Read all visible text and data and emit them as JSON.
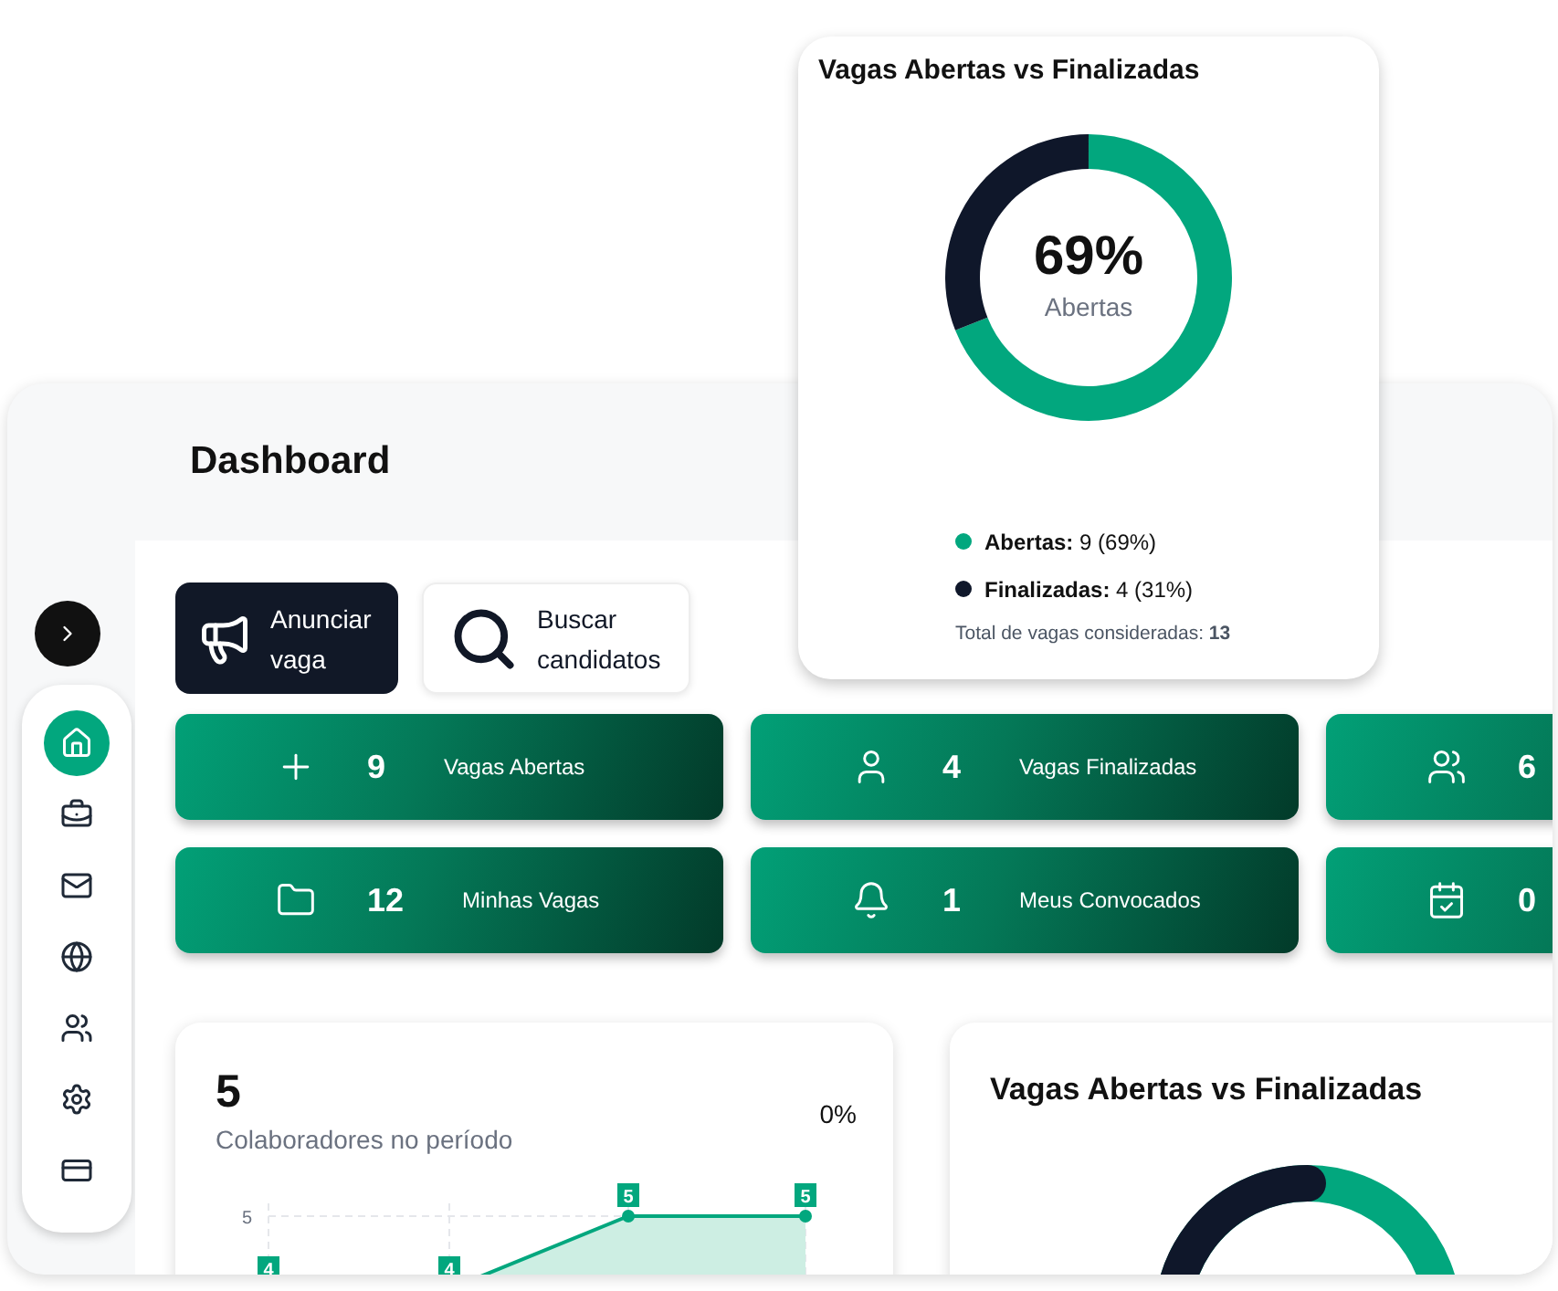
{
  "header": {
    "title": "Dashboard"
  },
  "sidebar": {
    "items": [
      {
        "selected": true
      },
      {
        "selected": false
      },
      {
        "selected": false
      },
      {
        "selected": false
      },
      {
        "selected": false
      },
      {
        "selected": false
      },
      {
        "selected": false
      }
    ]
  },
  "actions": [
    {
      "label": "Anunciar vaga",
      "kind": "primary"
    },
    {
      "label": "Buscar candidatos",
      "kind": "secondary"
    }
  ],
  "stat_rows": [
    {
      "cards": [
        {
          "label": "Vagas Abertas",
          "value": "9"
        },
        {
          "label": "Vagas Finalizadas",
          "value": "4"
        },
        {
          "value": "6"
        }
      ]
    },
    {
      "cards": [
        {
          "label": "Minhas Vagas",
          "value": "12"
        },
        {
          "label": "Meus Convocados",
          "value": "1"
        },
        {
          "value": "0"
        }
      ]
    }
  ],
  "summary_card": {
    "title": "Vagas Abertas vs Finalizadas",
    "center_value": "69%",
    "center_label": "Abertas",
    "legend": [
      {
        "text": "**Abertas:** 9 (69%)",
        "color": "#02a77e"
      },
      {
        "text": "**Finalizadas:** 4 (31%)",
        "color": "#0f172a"
      }
    ],
    "total": "Total de vagas consideradas: **13**",
    "chart_data": {
      "type": "donut",
      "values": [
        69,
        31
      ]
    }
  },
  "collaborators_card": {
    "value": "5",
    "label": "Colaboradores no período",
    "change": "0%",
    "axis_tick": "5",
    "point_labels": [
      "4",
      "4",
      "5",
      "5"
    ]
  },
  "vagas_card": {
    "title": "Vagas Abertas vs Finalizadas"
  }
}
